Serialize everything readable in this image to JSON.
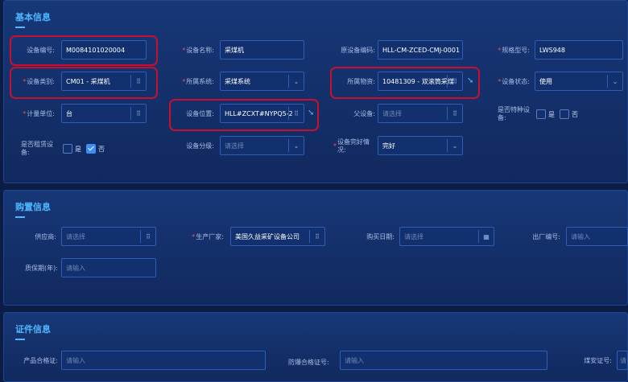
{
  "sections": {
    "basic": {
      "title": "基本信息"
    },
    "purchase": {
      "title": "购置信息"
    },
    "cert": {
      "title": "证件信息"
    }
  },
  "basic": {
    "device_no": {
      "label": "设备编号:",
      "value": "M0084101020004"
    },
    "device_name": {
      "label": "设备名称:",
      "value": "采煤机"
    },
    "orig_code": {
      "label": "原设备编码:",
      "value": "HLL-CM-ZCED-CMJ-0001"
    },
    "model": {
      "label": "规格型号:",
      "value": "LWS948"
    },
    "category": {
      "label": "设备类别:",
      "value": "CM01 - 采煤机"
    },
    "system": {
      "label": "所属系统:",
      "value": "采煤系统"
    },
    "material": {
      "label": "所属物资:",
      "value": "10481309 - 双滚筒采煤"
    },
    "status": {
      "label": "设备状态:",
      "value": "使用"
    },
    "unit": {
      "label": "计量单位:",
      "value": "台"
    },
    "location": {
      "label": "设备位置:",
      "value": "HLL#ZCXT#NYPQ5-2"
    },
    "parent": {
      "label": "父设备:",
      "placeholder": "请选择"
    },
    "special": {
      "label": "是否特种设备:",
      "yes": "是",
      "no": "否"
    },
    "leased": {
      "label": "是否租赁设备:",
      "yes": "是",
      "no": "否"
    },
    "grade": {
      "label": "设备分级:",
      "placeholder": "请选择"
    },
    "condition": {
      "label": "设备完好情况:",
      "value": "完好"
    }
  },
  "purchase": {
    "supplier": {
      "label": "供应商:",
      "placeholder": "请选择"
    },
    "manufacturer": {
      "label": "生产厂家:",
      "value": "美国久益采矿设备公司"
    },
    "buy_date": {
      "label": "购买日期:",
      "placeholder": "请选择"
    },
    "factory_no": {
      "label": "出厂编号:",
      "placeholder": "请输入"
    },
    "warranty": {
      "label": "质保期(年):",
      "placeholder": "请输入"
    }
  },
  "cert": {
    "product_cert": {
      "label": "产品合格证:",
      "placeholder": "请输入"
    },
    "explosion_cert": {
      "label": "防爆合格证号:",
      "placeholder": "请输入"
    },
    "coal_safety": {
      "label": "煤安证号:",
      "placeholder": "请"
    }
  },
  "icons": {
    "lookup": "search-select-icon",
    "chevron": "chevron-down-icon",
    "calendar": "calendar-icon",
    "jump": "jump-arrow-icon"
  },
  "colors": {
    "accent": "#4fb7ff",
    "required": "#ff4d4f",
    "highlight": "#c8102e"
  }
}
